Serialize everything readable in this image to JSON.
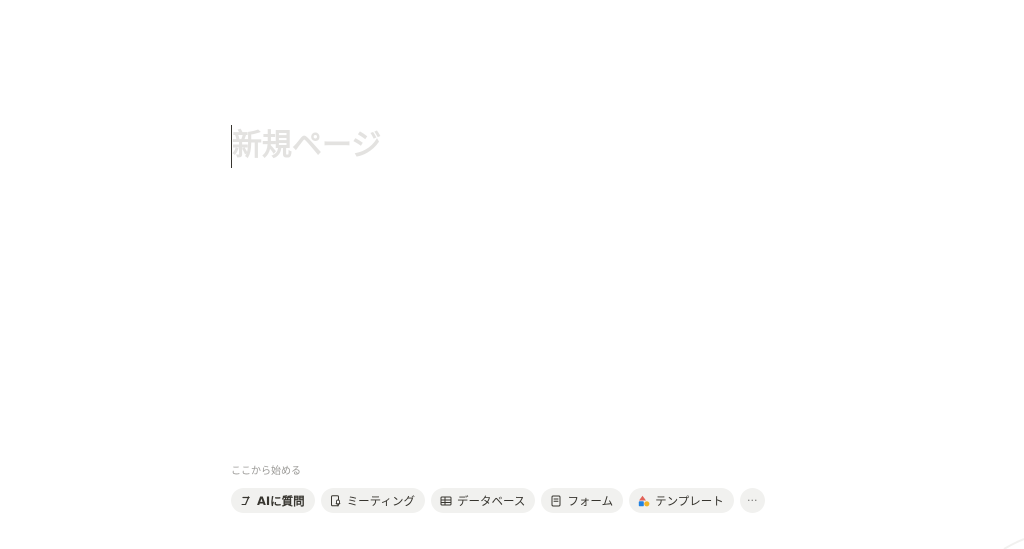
{
  "editor": {
    "title_placeholder": "新規ページ"
  },
  "quick_start": {
    "label": "ここから始める",
    "chips": [
      {
        "label": "AIに質問",
        "icon": "ai-sparkle-icon"
      },
      {
        "label": "ミーティング",
        "icon": "meeting-mic-icon"
      },
      {
        "label": "データベース",
        "icon": "table-icon"
      },
      {
        "label": "フォーム",
        "icon": "form-doc-icon"
      },
      {
        "label": "テンプレート",
        "icon": "template-shapes-icon"
      }
    ],
    "more_label": "···"
  },
  "colors": {
    "placeholder_text": "#e3e2e0",
    "chip_background": "#f1f1ef",
    "text": "#37352f",
    "muted_text": "#9b9a97"
  }
}
